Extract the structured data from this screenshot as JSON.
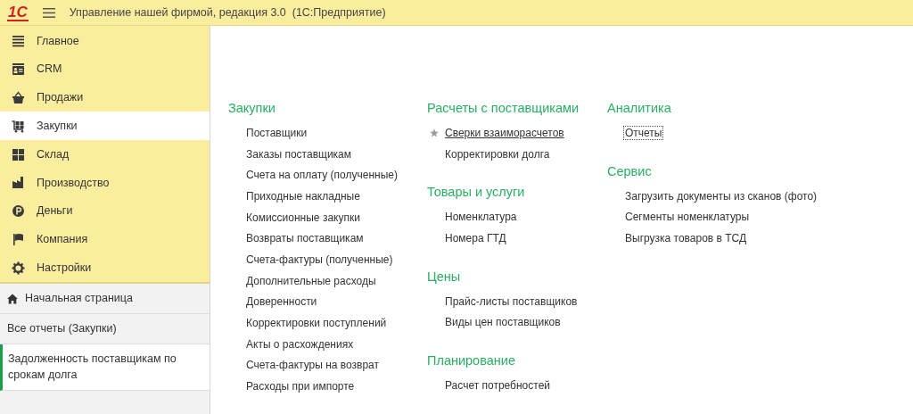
{
  "titlebar": {
    "logo": "1С",
    "title": "Управление нашей фирмой, редакция 3.0  (1С:Предприятие)"
  },
  "sections": [
    {
      "label": "Главное",
      "selected": false
    },
    {
      "label": "CRM",
      "selected": false
    },
    {
      "label": "Продажи",
      "selected": false
    },
    {
      "label": "Закупки",
      "selected": true
    },
    {
      "label": "Склад",
      "selected": false
    },
    {
      "label": "Производство",
      "selected": false
    },
    {
      "label": "Деньги",
      "selected": false
    },
    {
      "label": "Компания",
      "selected": false
    },
    {
      "label": "Настройки",
      "selected": false
    }
  ],
  "open_windows": [
    {
      "label": "Начальная страница",
      "kind": "home",
      "selected": false
    },
    {
      "label": "Все отчеты (Закупки)",
      "kind": "plain",
      "selected": false
    },
    {
      "label": "Задолженность поставщикам по срокам долга",
      "kind": "plain",
      "selected": true
    }
  ],
  "columns": [
    [
      {
        "title": "Закупки",
        "items": [
          {
            "label": "Поставщики",
            "starred": false,
            "hovered": false,
            "selected": false
          },
          {
            "label": "Заказы поставщикам",
            "starred": false,
            "hovered": false,
            "selected": false
          },
          {
            "label": "Счета на оплату (полученные)",
            "starred": false,
            "hovered": false,
            "selected": false
          },
          {
            "label": "Приходные накладные",
            "starred": false,
            "hovered": false,
            "selected": false
          },
          {
            "label": "Комиссионные закупки",
            "starred": false,
            "hovered": false,
            "selected": false
          },
          {
            "label": "Возвраты поставщикам",
            "starred": false,
            "hovered": false,
            "selected": false
          },
          {
            "label": "Счета-фактуры (полученные)",
            "starred": false,
            "hovered": false,
            "selected": false
          },
          {
            "label": "Дополнительные расходы",
            "starred": false,
            "hovered": false,
            "selected": false
          },
          {
            "label": "Доверенности",
            "starred": false,
            "hovered": false,
            "selected": false
          },
          {
            "label": "Корректировки поступлений",
            "starred": false,
            "hovered": false,
            "selected": false
          },
          {
            "label": "Акты о расхождениях",
            "starred": false,
            "hovered": false,
            "selected": false
          },
          {
            "label": "Счета-фактуры на возврат",
            "starred": false,
            "hovered": false,
            "selected": false
          },
          {
            "label": "Расходы при импорте",
            "starred": false,
            "hovered": false,
            "selected": false
          }
        ]
      }
    ],
    [
      {
        "title": "Расчеты с поставщиками",
        "items": [
          {
            "label": "Сверки взаиморасчетов",
            "starred": true,
            "hovered": true,
            "selected": false
          },
          {
            "label": "Корректировки долга",
            "starred": false,
            "hovered": false,
            "selected": false
          }
        ]
      },
      {
        "title": "Товары и услуги",
        "items": [
          {
            "label": "Номенклатура",
            "starred": false,
            "hovered": false,
            "selected": false
          },
          {
            "label": "Номера ГТД",
            "starred": false,
            "hovered": false,
            "selected": false
          }
        ]
      },
      {
        "title": "Цены",
        "items": [
          {
            "label": "Прайс-листы поставщиков",
            "starred": false,
            "hovered": false,
            "selected": false
          },
          {
            "label": "Виды цен поставщиков",
            "starred": false,
            "hovered": false,
            "selected": false
          }
        ]
      },
      {
        "title": "Планирование",
        "items": [
          {
            "label": "Расчет потребностей",
            "starred": false,
            "hovered": false,
            "selected": false
          }
        ]
      }
    ],
    [
      {
        "title": "Аналитика",
        "items": [
          {
            "label": "Отчеты",
            "starred": false,
            "hovered": false,
            "selected": true
          }
        ]
      },
      {
        "title": "Сервис",
        "items": [
          {
            "label": "Загрузить документы из сканов (фото)",
            "starred": false,
            "hovered": false,
            "selected": false
          },
          {
            "label": "Сегменты номенклатуры",
            "starred": false,
            "hovered": false,
            "selected": false
          },
          {
            "label": "Выгрузка товаров в ТСД",
            "starred": false,
            "hovered": false,
            "selected": false
          }
        ]
      }
    ]
  ]
}
